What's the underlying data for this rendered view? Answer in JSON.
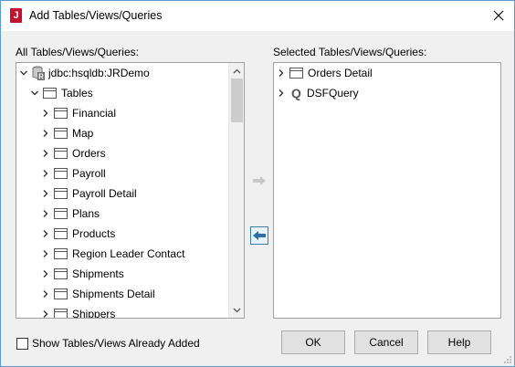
{
  "window": {
    "title": "Add Tables/Views/Queries",
    "app_icon_letter": "J"
  },
  "left_panel": {
    "label": "All Tables/Views/Queries:",
    "datasource": "jdbc:hsqldb:JRDemo",
    "group": "Tables",
    "items": [
      "Financial",
      "Map",
      "Orders",
      "Payroll",
      "Payroll Detail",
      "Plans",
      "Products",
      "Region Leader Contact",
      "Shipments",
      "Shipments Detail",
      "Shippers"
    ]
  },
  "right_panel": {
    "label": "Selected Tables/Views/Queries:",
    "items": [
      {
        "label": "Orders Detail",
        "icon": "table-icon"
      },
      {
        "label": "DSFQuery",
        "icon": "query-icon",
        "icon_letter": "Q"
      }
    ]
  },
  "checkbox": {
    "label": "Show Tables/Views Already Added",
    "checked": false
  },
  "buttons": {
    "ok": "OK",
    "cancel": "Cancel",
    "help": "Help"
  },
  "colors": {
    "accent_border": "#5b9bd5",
    "app_icon": "#c8102e",
    "move_left_arrow": "#2f6fa8",
    "move_right_arrow_disabled": "#c8c8c8"
  }
}
